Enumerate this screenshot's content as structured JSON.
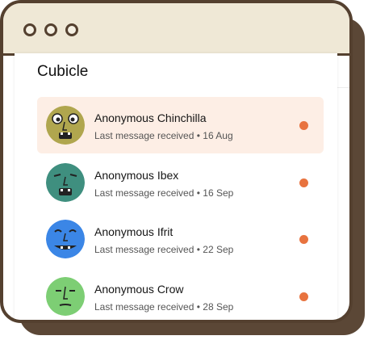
{
  "window": {
    "title_dots": 3
  },
  "sidebar": {
    "title": "Cubicle",
    "conversations": [
      {
        "name": "Anonymous Chinchilla",
        "meta": "Last message received • 16 Aug",
        "avatar_color": "#b0a64e",
        "active": true,
        "unread": true
      },
      {
        "name": "Anonymous Ibex",
        "meta": "Last message received • 16 Sep",
        "avatar_color": "#3f8f7f",
        "active": false,
        "unread": true
      },
      {
        "name": "Anonymous Ifrit",
        "meta": "Last message received • 22 Sep",
        "avatar_color": "#3b86e6",
        "active": false,
        "unread": true
      },
      {
        "name": "Anonymous Crow",
        "meta": "Last message received • 28 Sep",
        "avatar_color": "#7dce74",
        "active": false,
        "unread": true
      }
    ]
  },
  "colors": {
    "frame": "#54402f",
    "titlebar": "#efe8d6",
    "active_row": "#fdeee5",
    "unread_dot": "#e8733f"
  }
}
